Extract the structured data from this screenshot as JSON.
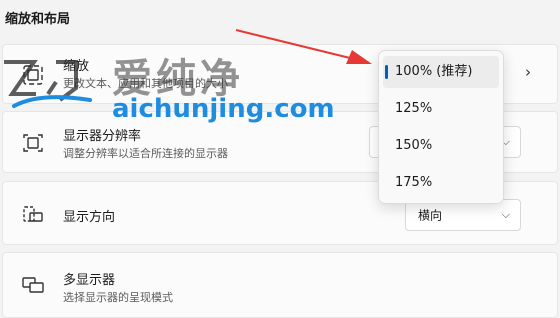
{
  "section": {
    "title": "缩放和布局"
  },
  "scale": {
    "title": "缩放",
    "subtitle": "更改文本、应用和其他项目的大小"
  },
  "resolution": {
    "title": "显示器分辨率",
    "subtitle": "调整分辨率以适合所连接的显示器"
  },
  "orientation": {
    "title": "显示方向",
    "value": "横向"
  },
  "multi_display": {
    "title": "多显示器",
    "subtitle": "选择显示器的呈现模式"
  },
  "scale_menu": {
    "options": [
      "100% (推荐)",
      "125%",
      "150%",
      "175%"
    ],
    "selected": "100% (推荐)"
  },
  "watermark": {
    "chinese": "爱纯净",
    "url": "aichunjing.com"
  },
  "colors": {
    "accent": "#005fb8",
    "arrow": "#e53935",
    "watermark_url": "#1e8de0"
  }
}
